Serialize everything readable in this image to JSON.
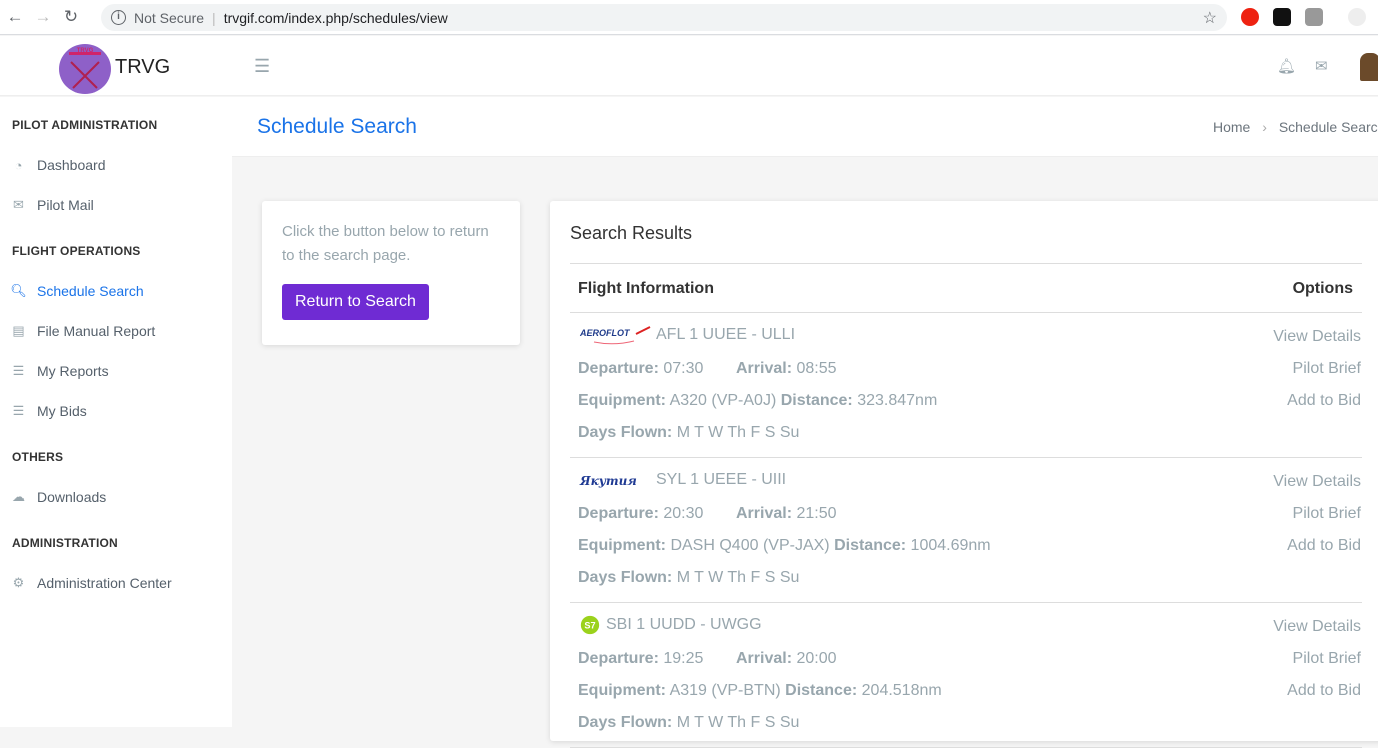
{
  "browser": {
    "security": "Not Secure",
    "url": "trvgif.com/index.php/schedules/view"
  },
  "header": {
    "brand": "TRVG",
    "logo_text": "TRVG"
  },
  "sidebar": {
    "sections": [
      {
        "title": "PILOT ADMINISTRATION",
        "items": [
          {
            "label": "Dashboard",
            "icon": "dashboard-icon"
          },
          {
            "label": "Pilot Mail",
            "icon": "envelope-icon"
          }
        ]
      },
      {
        "title": "FLIGHT OPERATIONS",
        "items": [
          {
            "label": "Schedule Search",
            "icon": "search-icon",
            "active": true
          },
          {
            "label": "File Manual Report",
            "icon": "file-icon"
          },
          {
            "label": "My Reports",
            "icon": "list-icon"
          },
          {
            "label": "My Bids",
            "icon": "list-icon"
          }
        ]
      },
      {
        "title": "OTHERS",
        "items": [
          {
            "label": "Downloads",
            "icon": "cloud-download-icon"
          }
        ]
      },
      {
        "title": "ADMINISTRATION",
        "items": [
          {
            "label": "Administration Center",
            "icon": "gear-icon"
          }
        ]
      }
    ]
  },
  "page": {
    "title": "Schedule Search",
    "breadcrumb": [
      "Home",
      "Schedule Search"
    ]
  },
  "info_card": {
    "text": "Click the button below to return to the search page.",
    "button": "Return to Search"
  },
  "results": {
    "title": "Search Results",
    "col_flight": "Flight Information",
    "col_options": "Options",
    "labels": {
      "departure": "Departure:",
      "arrival": "Arrival:",
      "equipment": "Equipment:",
      "distance": "Distance:",
      "days": "Days Flown:"
    },
    "options": [
      "View Details",
      "Pilot Brief",
      "Add to Bid"
    ],
    "flights": [
      {
        "airline_logo": "AEROFLOT",
        "title": "AFL 1 UUEE - ULLI",
        "departure": "07:30",
        "arrival": "08:55",
        "equipment": "A320 (VP-A0J)",
        "distance": "323.847nm",
        "days": "M T W Th F S Su"
      },
      {
        "airline_logo": "Якутия",
        "title": "SYL 1 UEEE - UIII",
        "departure": "20:30",
        "arrival": "21:50",
        "equipment": "DASH Q400 (VP-JAX)",
        "distance": "1004.69nm",
        "days": "M T W Th F S Su"
      },
      {
        "airline_logo": "S7",
        "title": "SBI 1 UUDD - UWGG",
        "departure": "19:25",
        "arrival": "20:00",
        "equipment": "A319 (VP-BTN)",
        "distance": "204.518nm",
        "days": "M T W Th F S Su"
      }
    ]
  }
}
